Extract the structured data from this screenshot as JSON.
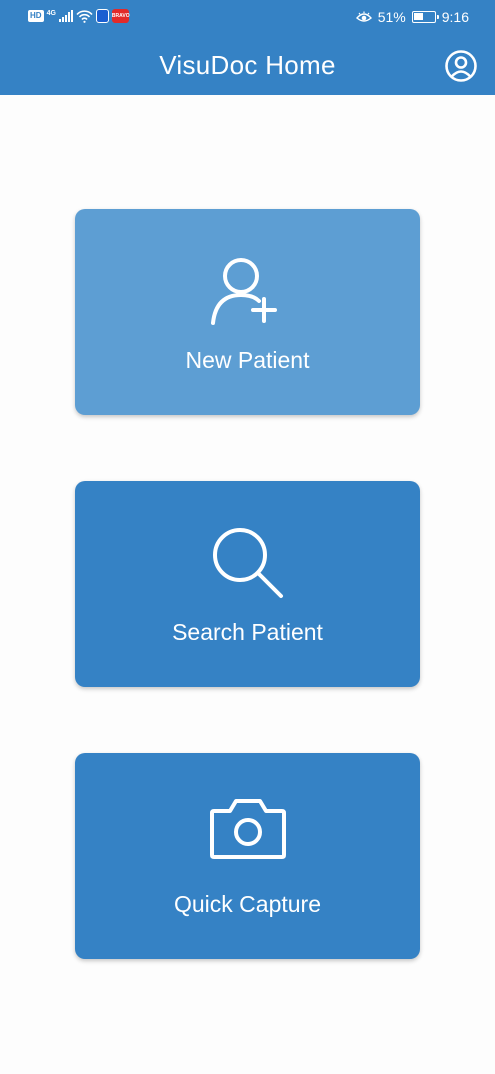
{
  "status_bar": {
    "hd": "HD",
    "network": "4G",
    "app_badge": "BRAVO",
    "battery_percent": 51,
    "battery_text": "51%",
    "time": "9:16"
  },
  "app_bar": {
    "title": "VisuDoc Home",
    "account_icon": "account-circle-icon"
  },
  "cards": [
    {
      "label": "New Patient",
      "icon": "person-add-icon",
      "color": "#5d9ed3"
    },
    {
      "label": "Search Patient",
      "icon": "search-icon",
      "color": "#3582c5"
    },
    {
      "label": "Quick Capture",
      "icon": "camera-icon",
      "color": "#3582c5"
    }
  ],
  "colors": {
    "primary": "#3582c5",
    "highlight_card": "#5d9ed3",
    "background": "#fdfdfd",
    "foreground": "#ffffff"
  }
}
